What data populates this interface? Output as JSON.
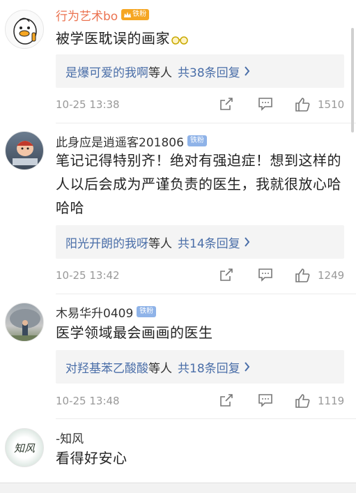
{
  "comments": [
    {
      "username": "行为艺术bo",
      "badge": "铁粉",
      "text": "被学医耽误的画家",
      "reply_names": "是爆可爱的我啊",
      "reply_suffix": "等人",
      "reply_count": "共38条回复",
      "time": "10-25 13:38",
      "likes": "1510"
    },
    {
      "username": "此身应是逍遥客201806",
      "badge": "铁粉",
      "text": "笔记记得特别齐！绝对有强迫症！想到这样的人以后会成为严谨负责的医生，我就很放心哈哈哈",
      "reply_names": "阳光开朗的我呀",
      "reply_suffix": "等人",
      "reply_count": "共14条回复",
      "time": "10-25 13:42",
      "likes": "1249"
    },
    {
      "username": "木易华升0409",
      "badge": "铁粉",
      "text": "医学领域最会画画的医生",
      "reply_names": "对羟基苯乙酸酸",
      "reply_suffix": "等人",
      "reply_count": "共18条回复",
      "time": "10-25 13:48",
      "likes": "1119"
    },
    {
      "username": "-知风",
      "text": "看得好安心",
      "avatar_text": "知风"
    }
  ],
  "colors": {
    "vip_name": "#eb7350",
    "link": "#4a6ea8",
    "meta": "#999999"
  },
  "icons": [
    "duck-avatar-icon",
    "glasses-emoji-icon",
    "share-icon",
    "comment-icon",
    "like-icon",
    "chevron-right-icon"
  ]
}
